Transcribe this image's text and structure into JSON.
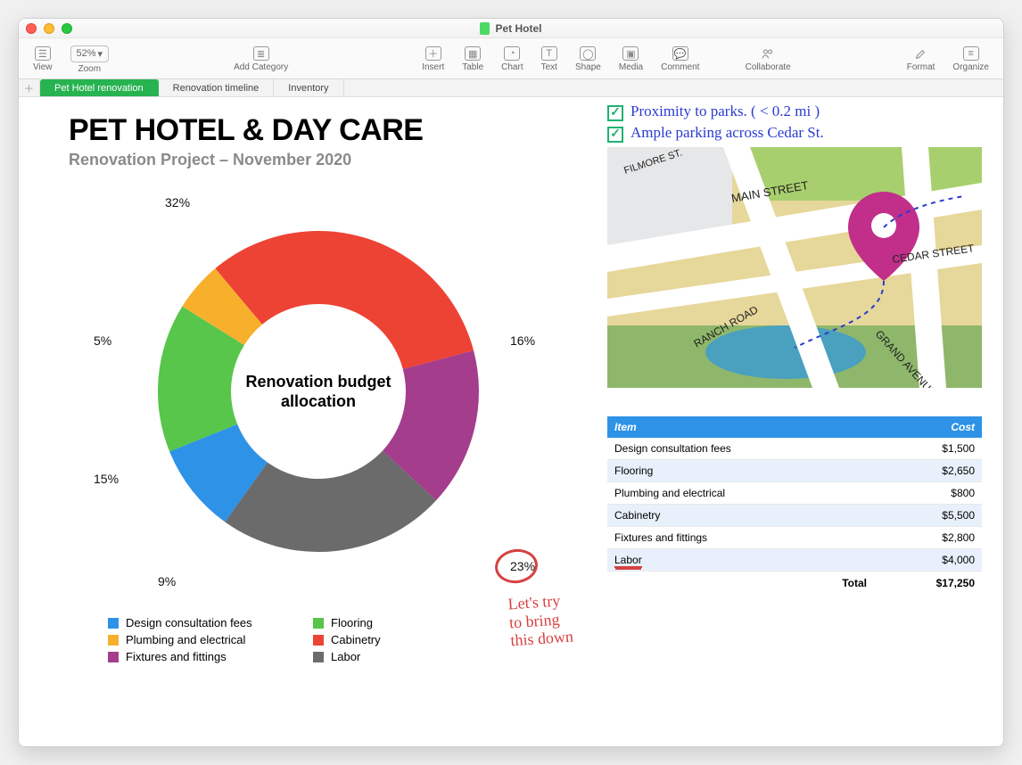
{
  "window_title": "Pet Hotel",
  "toolbar": {
    "view": "View",
    "zoom_value": "52%",
    "zoom": "Zoom",
    "add_category": "Add Category",
    "insert": "Insert",
    "table": "Table",
    "chart": "Chart",
    "text": "Text",
    "shape": "Shape",
    "media": "Media",
    "comment": "Comment",
    "collaborate": "Collaborate",
    "format": "Format",
    "organize": "Organize"
  },
  "sheets": [
    {
      "label": "Pet Hotel renovation",
      "active": true
    },
    {
      "label": "Renovation timeline",
      "active": false
    },
    {
      "label": "Inventory",
      "active": false
    }
  ],
  "page": {
    "title": "PET HOTEL & DAY CARE",
    "subtitle": "Renovation Project – November 2020",
    "donut_center": "Renovation budget allocation"
  },
  "chart_data": {
    "type": "pie",
    "title": "Renovation budget allocation",
    "series": [
      {
        "name": "Design consultation fees",
        "value": 9,
        "value_label": "9%",
        "color": "#2e92e6"
      },
      {
        "name": "Flooring",
        "value": 15,
        "value_label": "15%",
        "color": "#57c64b"
      },
      {
        "name": "Plumbing and electrical",
        "value": 5,
        "value_label": "5%",
        "color": "#f6b02c"
      },
      {
        "name": "Cabinetry",
        "value": 32,
        "value_label": "32%",
        "color": "#ed4335"
      },
      {
        "name": "Fixtures and fittings",
        "value": 16,
        "value_label": "16%",
        "color": "#a43d8c"
      },
      {
        "name": "Labor",
        "value": 23,
        "value_label": "23%",
        "color": "#6b6b6b"
      }
    ]
  },
  "annotations": {
    "check1": "Proximity to parks. ( < 0.2 mi )",
    "check2": "Ample parking across  Cedar St.",
    "red_note": "Let's try\nto bring\nthis down"
  },
  "map": {
    "streets": [
      "FILMORE ST.",
      "MAIN STREET",
      "CEDAR STREET",
      "RANCH ROAD",
      "GRAND AVENUE"
    ]
  },
  "table": {
    "headers": [
      "Item",
      "Cost"
    ],
    "rows": [
      {
        "item": "Design consultation fees",
        "cost": "$1,500"
      },
      {
        "item": "Flooring",
        "cost": "$2,650"
      },
      {
        "item": "Plumbing and electrical",
        "cost": "$800"
      },
      {
        "item": "Cabinetry",
        "cost": "$5,500"
      },
      {
        "item": "Fixtures and fittings",
        "cost": "$2,800"
      },
      {
        "item": "Labor",
        "cost": "$4,000"
      }
    ],
    "total_label": "Total",
    "total": "$17,250"
  }
}
